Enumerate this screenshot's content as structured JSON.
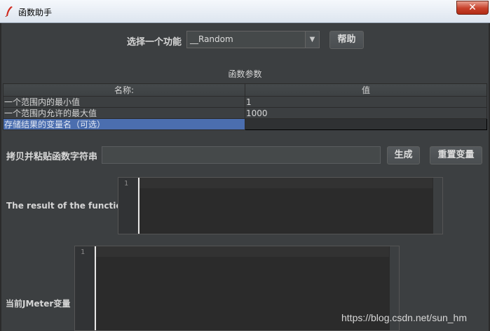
{
  "window": {
    "title": "函数助手",
    "close_glyph": "✕"
  },
  "function_selector": {
    "label": "选择一个功能",
    "selected": "__Random",
    "help_button": "帮助"
  },
  "parameters": {
    "section_title": "函数参数",
    "columns": [
      "名称:",
      "值"
    ],
    "rows": [
      {
        "name": "一个范围内的最小值",
        "value": "1"
      },
      {
        "name": "一个范围内允许的最大值",
        "value": "1000"
      },
      {
        "name": "存储结果的变量名（可选）",
        "value": ""
      }
    ]
  },
  "copy_paste": {
    "label": "拷贝并粘贴函数字符串",
    "value": "",
    "generate_button": "生成",
    "reset_button": "重置变量"
  },
  "result": {
    "label": "The result of the function is",
    "line_number": "1"
  },
  "jmeter_vars": {
    "label": "当前JMeter变量",
    "line_number": "1"
  },
  "watermark": "https://blog.csdn.net/sun_hm",
  "colors": {
    "background": "#3c3f41",
    "selection": "#4b6eaf",
    "editor": "#2b2b2b"
  }
}
